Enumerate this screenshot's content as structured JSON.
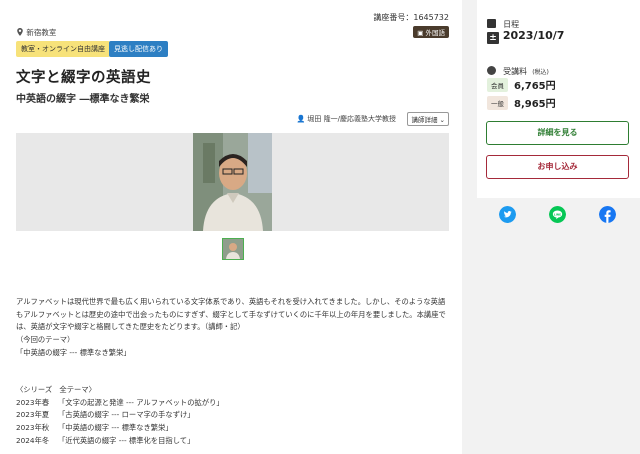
{
  "course": {
    "location": "新宿教室",
    "code_label": "講座番号：1645732",
    "foreign_badge": "外国語",
    "tags": [
      "教室・オンライン自由講座",
      "見逃し配信あり"
    ],
    "title": "文字と綴字の英語史",
    "subtitle": "中英語の綴字 ―標準なき繁栄",
    "lecturer": "堀田 隆一/慶応義塾大学教授",
    "lecturer_details_label": "講師詳細",
    "description": [
      "アルファベットは現代世界で最も広く用いられている文字体系であり、英語もそれを受け入れてきました。しかし、そのような英語",
      "もアルファベットとは歴史の途中で出会ったものにすぎず、綴字として手なずけていくのに千年以上の年月を要しました。本講座で",
      "は、英語が文字や綴字と格闘してきた歴史をたどります。（講師・記）",
      "（今回のテーマ）",
      "「中英語の綴字 --- 標準なき繁栄」"
    ],
    "series_heading": "〈シリーズ　全テーマ〉",
    "series": [
      {
        "term": "2023年春",
        "theme": "「文字の起源と発達 --- アルファベットの拡がり」"
      },
      {
        "term": "2023年夏",
        "theme": "「古英語の綴字 --- ローマ字の手なずけ」"
      },
      {
        "term": "2023年秋",
        "theme": "「中英語の綴字 --- 標準なき繁栄」"
      },
      {
        "term": "2024年冬",
        "theme": "「近代英語の綴字 --- 標準化を目指して」"
      }
    ]
  },
  "sidebar": {
    "schedule_label": "日程",
    "date": "2023/10/7",
    "fee_label": "受講料",
    "fee_tax": "(税込)",
    "member_label": "会員",
    "member_price": "6,765円",
    "general_label": "一般",
    "general_price": "8,965円",
    "detail_button": "詳細を見る",
    "apply_button": "お申し込み"
  },
  "colors": {
    "accent_green": "#2e7d32",
    "accent_red": "#a52a3a",
    "twitter": "#1d9bf0",
    "line": "#06c755",
    "facebook": "#1877f2"
  }
}
